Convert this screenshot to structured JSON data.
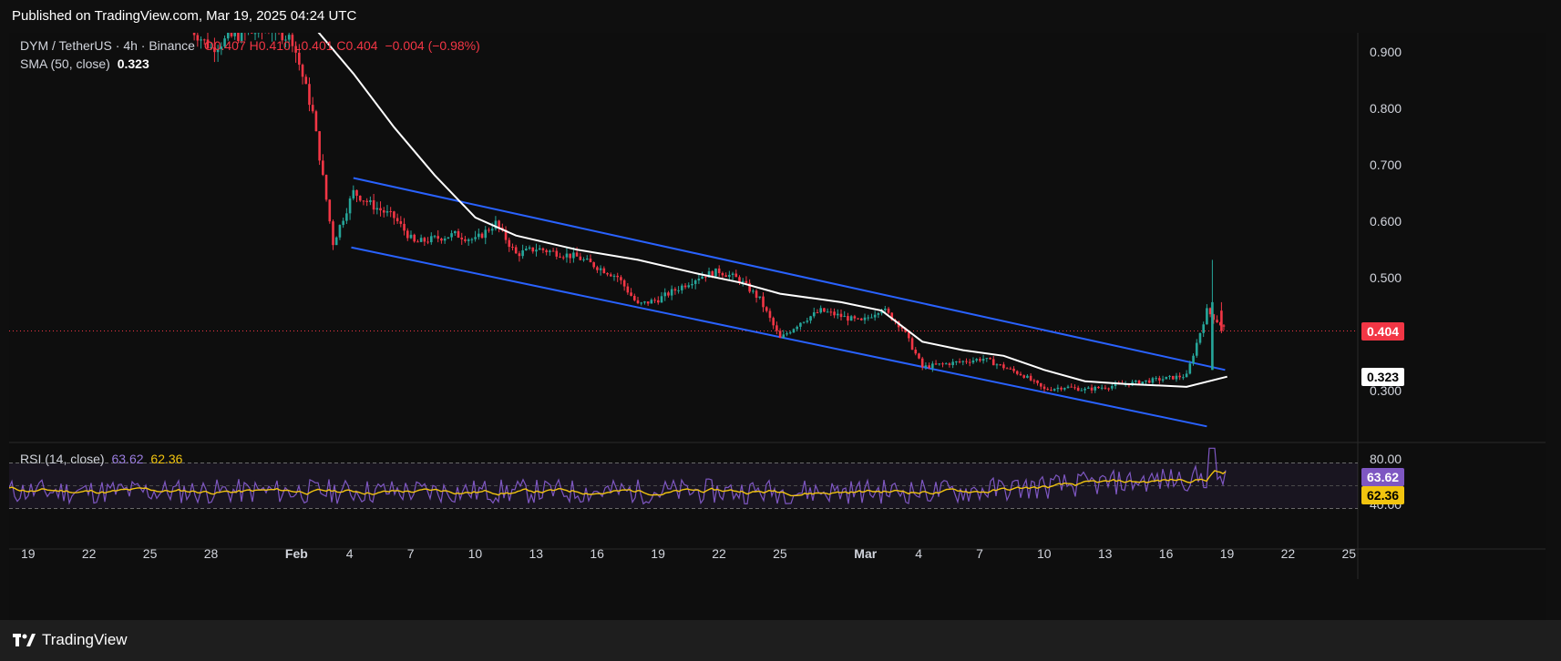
{
  "header": {
    "published": "Published on TradingView.com, Mar 19, 2025 04:24 UTC"
  },
  "legend": {
    "symbol": "DYM / TetherUS · 4h · Binance",
    "open": "O0.407",
    "high": "H0.410",
    "low": "L0.401",
    "close": "C0.404",
    "change": "−0.004 (−0.98%)",
    "sma_label": "SMA (50, close)",
    "sma_value": "0.323",
    "rsi_label": "RSI (14, close)",
    "rsi_value": "63.62",
    "rsi_ma_value": "62.36"
  },
  "price_axis": {
    "ticks": [
      "0.900",
      "0.800",
      "0.700",
      "0.600",
      "0.500",
      "0.300"
    ],
    "last_price": "0.404",
    "sma_badge": "0.323"
  },
  "rsi_axis": {
    "ticks": [
      "80.00",
      "40.00"
    ],
    "rsi_badge": "63.62",
    "rsi_ma_badge": "62.36"
  },
  "time_axis": [
    "19",
    "22",
    "25",
    "28",
    "Feb",
    "4",
    "7",
    "10",
    "13",
    "16",
    "19",
    "22",
    "25",
    "Mar",
    "4",
    "7",
    "10",
    "13",
    "16",
    "19",
    "22",
    "25"
  ],
  "footer": {
    "brand": "TradingView"
  },
  "colors": {
    "up": "#26a69a",
    "down": "#f23645",
    "sma": "#ffffff",
    "channel": "#2962ff",
    "rsi": "#7e57c2",
    "rsi_ma": "#f1c40f",
    "last_price_badge": "#f23645",
    "rsi_badge": "#7e57c2",
    "rsi_ma_badge": "#f1c40f"
  },
  "chart_data": {
    "type": "candlestick",
    "title": "DYM / TetherUS · 4h · Binance",
    "price_range": [
      0.2,
      0.95
    ],
    "channel": {
      "upper": [
        [
          "Feb 4",
          0.675
        ],
        [
          "Mar 18",
          0.335
        ]
      ],
      "lower": [
        [
          "Feb 3",
          0.552
        ],
        [
          "Mar 18",
          0.235
        ]
      ]
    },
    "sma_50": [
      [
        "Feb 2",
        0.945
      ],
      [
        "Feb 4",
        0.86
      ],
      [
        "Feb 6",
        0.765
      ],
      [
        "Feb 8",
        0.68
      ],
      [
        "Feb 10",
        0.605
      ],
      [
        "Feb 12",
        0.573
      ],
      [
        "Feb 15",
        0.548
      ],
      [
        "Feb 18",
        0.53
      ],
      [
        "Feb 21",
        0.505
      ],
      [
        "Feb 23",
        0.49
      ],
      [
        "Feb 25",
        0.47
      ],
      [
        "Feb 28",
        0.455
      ],
      [
        "Mar 2",
        0.44
      ],
      [
        "Mar 4",
        0.385
      ],
      [
        "Mar 6",
        0.37
      ],
      [
        "Mar 8",
        0.36
      ],
      [
        "Mar 10",
        0.335
      ],
      [
        "Mar 12",
        0.315
      ],
      [
        "Mar 14",
        0.31
      ],
      [
        "Mar 16",
        0.307
      ],
      [
        "Mar 17",
        0.305
      ],
      [
        "Mar 19",
        0.323
      ]
    ],
    "price_path": [
      [
        "Jan 27",
        0.94
      ],
      [
        "Jan 28",
        0.905
      ],
      [
        "Jan 29",
        0.925
      ],
      [
        "Jan 31",
        0.94
      ],
      [
        "Feb 1",
        0.92
      ],
      [
        "Feb 2",
        0.79
      ],
      [
        "Feb 3",
        0.56
      ],
      [
        "Feb 4",
        0.65
      ],
      [
        "Feb 5",
        0.625
      ],
      [
        "Feb 6",
        0.605
      ],
      [
        "Feb 7",
        0.56
      ],
      [
        "Feb 9",
        0.575
      ],
      [
        "Feb 10",
        0.565
      ],
      [
        "Feb 11",
        0.595
      ],
      [
        "Feb 12",
        0.54
      ],
      [
        "Feb 13",
        0.55
      ],
      [
        "Feb 15",
        0.535
      ],
      [
        "Feb 17",
        0.5
      ],
      [
        "Feb 18",
        0.45
      ],
      [
        "Feb 19",
        0.46
      ],
      [
        "Feb 21",
        0.5
      ],
      [
        "Feb 22",
        0.51
      ],
      [
        "Feb 23",
        0.495
      ],
      [
        "Feb 24",
        0.46
      ],
      [
        "Feb 25",
        0.39
      ],
      [
        "Feb 26",
        0.42
      ],
      [
        "Feb 27",
        0.44
      ],
      [
        "Feb 28",
        0.43
      ],
      [
        "Mar 1",
        0.42
      ],
      [
        "Mar 2",
        0.445
      ],
      [
        "Mar 3",
        0.41
      ],
      [
        "Mar 4",
        0.34
      ],
      [
        "Mar 5",
        0.345
      ],
      [
        "Mar 6",
        0.35
      ],
      [
        "Mar 7",
        0.355
      ],
      [
        "Mar 8",
        0.34
      ],
      [
        "Mar 9",
        0.325
      ],
      [
        "Mar 10",
        0.3
      ],
      [
        "Mar 11",
        0.305
      ],
      [
        "Mar 12",
        0.3
      ],
      [
        "Mar 13",
        0.305
      ],
      [
        "Mar 14",
        0.31
      ],
      [
        "Mar 15",
        0.315
      ],
      [
        "Mar 16",
        0.32
      ],
      [
        "Mar 17",
        0.325
      ],
      [
        "Mar 18",
        0.44
      ],
      [
        "Mar 19",
        0.404
      ]
    ],
    "rsi": {
      "value": 63.62,
      "ma": 62.36,
      "band": [
        30,
        70
      ],
      "levels": [
        80,
        40
      ]
    },
    "grid": false,
    "legend": "top-left"
  }
}
